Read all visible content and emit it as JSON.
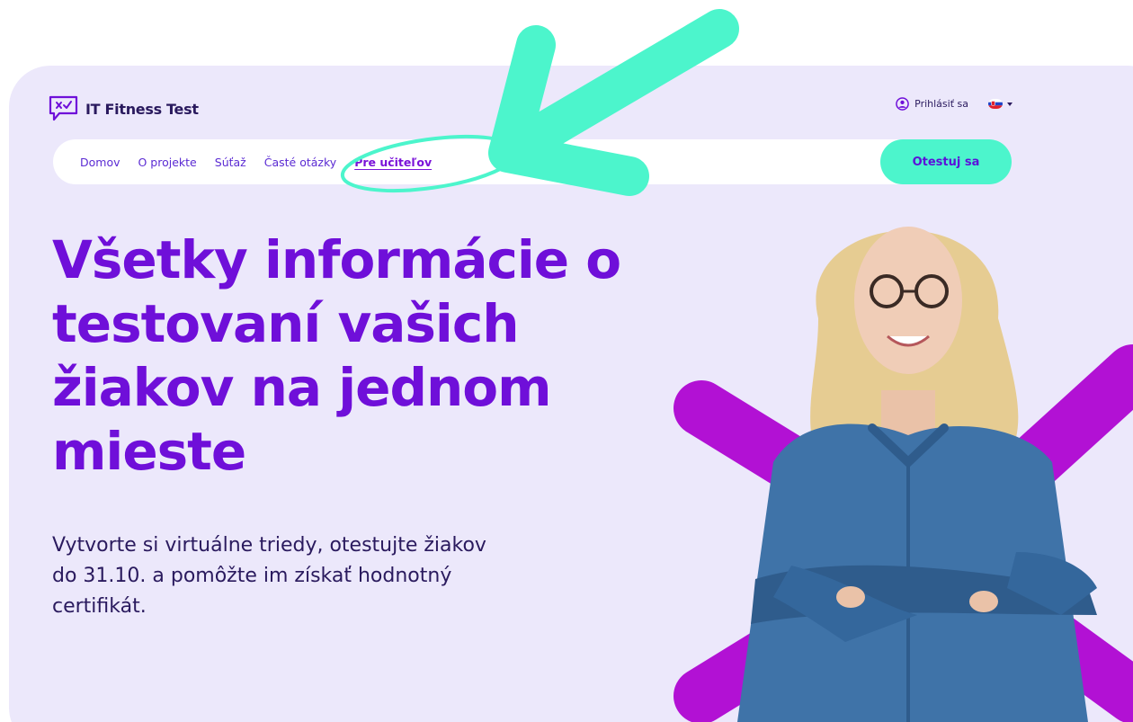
{
  "brand": {
    "name": "IT Fitness Test"
  },
  "header": {
    "login_label": "Prihlásiť sa",
    "login_icon": "user-circle-icon",
    "language_icon": "slovak-flag-icon"
  },
  "nav": {
    "items": [
      {
        "label": "Domov"
      },
      {
        "label": "O projekte"
      },
      {
        "label": "Súťaž"
      },
      {
        "label": "Časté otázky"
      },
      {
        "label": "Pre učiteľov",
        "active": true
      }
    ],
    "cta_label": "Otestuj sa"
  },
  "hero": {
    "title_lines": [
      "Všetky informácie o",
      "testovaní vašich",
      "žiakov na jednom",
      "mieste"
    ],
    "subtitle_lines": [
      "Vytvorte si virtuálne triedy, otestujte žiakov",
      "do 31.10. a pomôžte im získať hodnotný",
      "certifikát."
    ]
  },
  "colors": {
    "accent_purple": "#6f0fd9",
    "accent_mint": "#4cf5cc",
    "background_lavender": "#ece8fb",
    "text_dark": "#2a1a5e"
  }
}
